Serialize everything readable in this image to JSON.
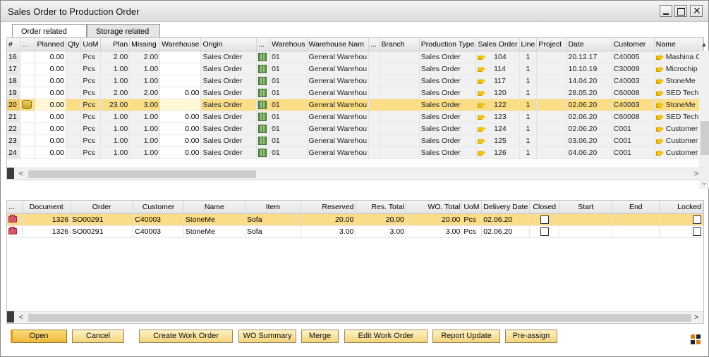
{
  "window": {
    "title": "Sales Order to Production Order"
  },
  "tabs": [
    {
      "label": "Order related"
    },
    {
      "label": "Storage related"
    }
  ],
  "top_grid": {
    "columns": [
      "#",
      "...",
      "Planned",
      "Qty",
      "UoM",
      "Plan",
      "Missing",
      "Warehouse",
      "Origin",
      "...",
      "Warehous",
      "Warehouse Nam",
      "...",
      "Branch",
      "Production Type",
      "Sales Order",
      "Line",
      "Project",
      "Date",
      "Customer",
      "Name"
    ],
    "rows": [
      {
        "num": "16",
        "planned": "0.00",
        "uom": "Pcs",
        "plan": "2.00",
        "missing": "2.00",
        "warehouse": "",
        "origin": "Sales Order",
        "whs": "01",
        "whs_name": "General Warehou",
        "branch": "",
        "prod_type": "Sales Order",
        "so": "104",
        "line": "1",
        "project": "",
        "date": "20.12.17",
        "customer": "C40005",
        "name": "Mashina C"
      },
      {
        "num": "17",
        "planned": "0.00",
        "uom": "Pcs",
        "plan": "1.00",
        "missing": "1.00",
        "warehouse": "",
        "origin": "Sales Order",
        "whs": "01",
        "whs_name": "General Warehou",
        "branch": "",
        "prod_type": "Sales Order",
        "so": "114",
        "line": "1",
        "project": "",
        "date": "10.10.19",
        "customer": "C30009",
        "name": "Microchip"
      },
      {
        "num": "18",
        "planned": "0.00",
        "uom": "Pcs",
        "plan": "1.00",
        "missing": "1.00",
        "warehouse": "",
        "origin": "Sales Order",
        "whs": "01",
        "whs_name": "General Warehou",
        "branch": "",
        "prod_type": "Sales Order",
        "so": "117",
        "line": "1",
        "project": "",
        "date": "14.04.20",
        "customer": "C40003",
        "name": "StoneMe"
      },
      {
        "num": "19",
        "planned": "0.00",
        "uom": "Pcs",
        "plan": "2.00",
        "missing": "2.00",
        "warehouse": "0.00",
        "origin": "Sales Order",
        "whs": "01",
        "whs_name": "General Warehou",
        "branch": "",
        "prod_type": "Sales Order",
        "so": "120",
        "line": "1",
        "project": "",
        "date": "28.05.20",
        "customer": "C60008",
        "name": "SED Tech"
      },
      {
        "num": "20",
        "planned": "0.00",
        "uom": "Pcs",
        "plan": "23.00",
        "missing": "3.00",
        "warehouse": "",
        "origin": "Sales Order",
        "whs": "01",
        "whs_name": "General Warehou",
        "branch": "",
        "prod_type": "Sales Order",
        "so": "122",
        "line": "1",
        "project": "",
        "date": "02.06.20",
        "customer": "C40003",
        "name": "StoneMe"
      },
      {
        "num": "21",
        "planned": "0.00",
        "uom": "Pcs",
        "plan": "1.00",
        "missing": "1.00",
        "warehouse": "0.00",
        "origin": "Sales Order",
        "whs": "01",
        "whs_name": "General Warehou",
        "branch": "",
        "prod_type": "Sales Order",
        "so": "123",
        "line": "1",
        "project": "",
        "date": "02.06.20",
        "customer": "C60008",
        "name": "SED Tech"
      },
      {
        "num": "22",
        "planned": "0.00",
        "uom": "Pcs",
        "plan": "1.00",
        "missing": "1.00",
        "warehouse": "0.00",
        "origin": "Sales Order",
        "whs": "01",
        "whs_name": "General Warehou",
        "branch": "",
        "prod_type": "Sales Order",
        "so": "124",
        "line": "1",
        "project": "",
        "date": "02.06.20",
        "customer": "C001",
        "name": "Customer"
      },
      {
        "num": "23",
        "planned": "0.00",
        "uom": "Pcs",
        "plan": "1.00",
        "missing": "1.00",
        "warehouse": "0.00",
        "origin": "Sales Order",
        "whs": "01",
        "whs_name": "General Warehou",
        "branch": "",
        "prod_type": "Sales Order",
        "so": "125",
        "line": "1",
        "project": "",
        "date": "03.06.20",
        "customer": "C001",
        "name": "Customer"
      },
      {
        "num": "24",
        "planned": "0.00",
        "uom": "Pcs",
        "plan": "1.00",
        "missing": "1.00",
        "warehouse": "0.00",
        "origin": "Sales Order",
        "whs": "01",
        "whs_name": "General Warehou",
        "branch": "",
        "prod_type": "Sales Order",
        "so": "126",
        "line": "1",
        "project": "",
        "date": "04.06.20",
        "customer": "C001",
        "name": "Customer"
      }
    ]
  },
  "bottom_grid": {
    "columns": [
      "...",
      "Document",
      "Order",
      "Customer",
      "Name",
      "Item",
      "Reserved",
      "Res. Total",
      "WO. Total",
      "UoM",
      "Delivery Date",
      "Closed",
      "Start",
      "End",
      "Locked"
    ],
    "rows": [
      {
        "doc": "1326",
        "order": "SO00291",
        "customer": "C40003",
        "name": "StoneMe",
        "item": "Sofa",
        "reserved": "20.00",
        "res_total": "20.00",
        "wo_total": "20.00",
        "uom": "Pcs",
        "delivery": "02.06.20",
        "start": "",
        "end": ""
      },
      {
        "doc": "1326",
        "order": "SO00291",
        "customer": "C40003",
        "name": "StoneMe",
        "item": "Sofa",
        "reserved": "3.00",
        "res_total": "3.00",
        "wo_total": "3.00",
        "uom": "Pcs",
        "delivery": "02.06.20",
        "start": "",
        "end": ""
      }
    ]
  },
  "buttons": {
    "open": "Open",
    "cancel": "Cancel",
    "create_wo": "Create Work Order",
    "wo_summary": "WO Summary",
    "merge": "Merge",
    "edit_wo": "Edit Work Order",
    "report_update": "Report Update",
    "pre_assign": "Pre-assign"
  },
  "colors": {
    "selection": "#fbdd85",
    "button": "#f2d37a",
    "accent": "#e49a12"
  }
}
